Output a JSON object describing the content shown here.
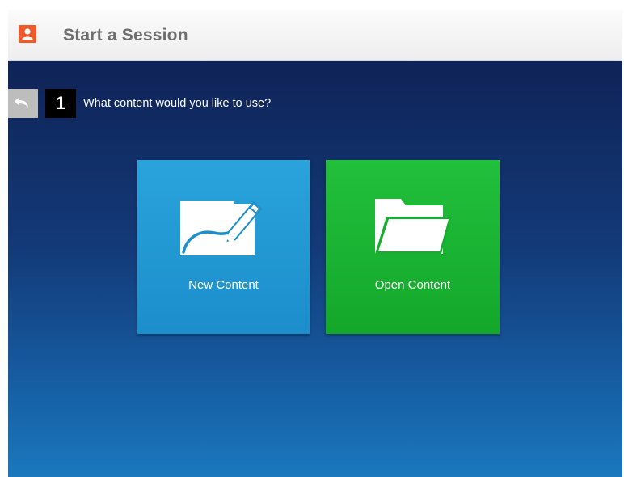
{
  "window": {
    "title": "Start a Session",
    "app_icon": "person-badge-icon",
    "accent_color": "#ef5a2a"
  },
  "wizard": {
    "back_icon": "back-arrow-icon",
    "step_number": "1",
    "question": "What content would you like to use?"
  },
  "options": [
    {
      "label": "New Content",
      "icon": "pen-on-paper-icon",
      "color": "#1e94d0"
    },
    {
      "label": "Open Content",
      "icon": "open-folder-icon",
      "color": "#19b132"
    }
  ],
  "colors": {
    "background_top": "#0f2357",
    "background_bottom": "#1b78bd",
    "title_text": "#6e6e6e"
  }
}
